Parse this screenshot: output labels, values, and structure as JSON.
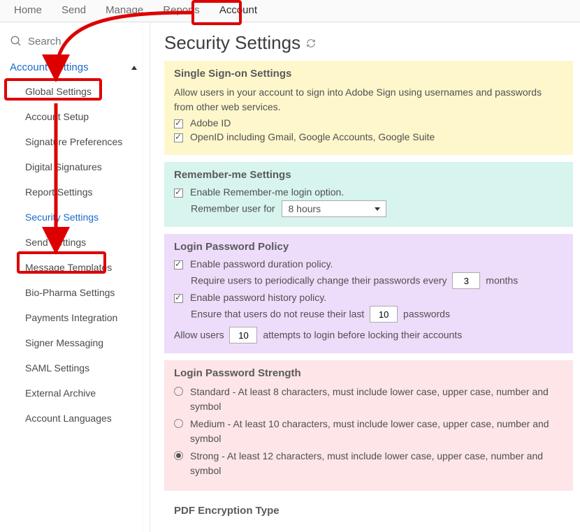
{
  "topnav": {
    "items": [
      "Home",
      "Send",
      "Manage",
      "Reports",
      "Account"
    ],
    "active": "Account"
  },
  "sidebar": {
    "search_placeholder": "Search",
    "group_label": "Account Settings",
    "items": [
      {
        "label": "Global Settings"
      },
      {
        "label": "Account Setup"
      },
      {
        "label": "Signature Preferences"
      },
      {
        "label": "Digital Signatures"
      },
      {
        "label": "Report Settings"
      },
      {
        "label": "Security Settings",
        "active": true
      },
      {
        "label": "Send Settings"
      },
      {
        "label": "Message Templates"
      },
      {
        "label": "Bio-Pharma Settings"
      },
      {
        "label": "Payments Integration"
      },
      {
        "label": "Signer Messaging"
      },
      {
        "label": "SAML Settings"
      },
      {
        "label": "External Archive"
      },
      {
        "label": "Account Languages"
      }
    ]
  },
  "page": {
    "title": "Security Settings"
  },
  "sso": {
    "heading": "Single Sign-on Settings",
    "desc": "Allow users in your account to sign into Adobe Sign using usernames and passwords from other web services.",
    "opt1": "Adobe ID",
    "opt2": "OpenID including Gmail, Google Accounts, Google Suite"
  },
  "remember": {
    "heading": "Remember-me Settings",
    "enable": "Enable Remember-me login option.",
    "prefix": "Remember user for",
    "value": "8 hours"
  },
  "policy": {
    "heading": "Login Password Policy",
    "duration_enable": "Enable password duration policy.",
    "duration_pre": "Require users to periodically change their passwords every",
    "duration_val": "3",
    "duration_suf": "months",
    "history_enable": "Enable password history policy.",
    "history_pre": "Ensure that users do not reuse their last",
    "history_val": "10",
    "history_suf": "passwords",
    "attempts_pre": "Allow users",
    "attempts_val": "10",
    "attempts_suf": "attempts to login before locking their accounts"
  },
  "strength": {
    "heading": "Login Password Strength",
    "standard": "Standard - At least 8 characters, must include lower case, upper case, number and symbol",
    "medium": "Medium - At least 10 characters, must include lower case, upper case, number and symbol",
    "strong": "Strong - At least 12 characters, must include lower case, upper case, number and symbol"
  },
  "pdf": {
    "heading": "PDF Encryption Type"
  }
}
